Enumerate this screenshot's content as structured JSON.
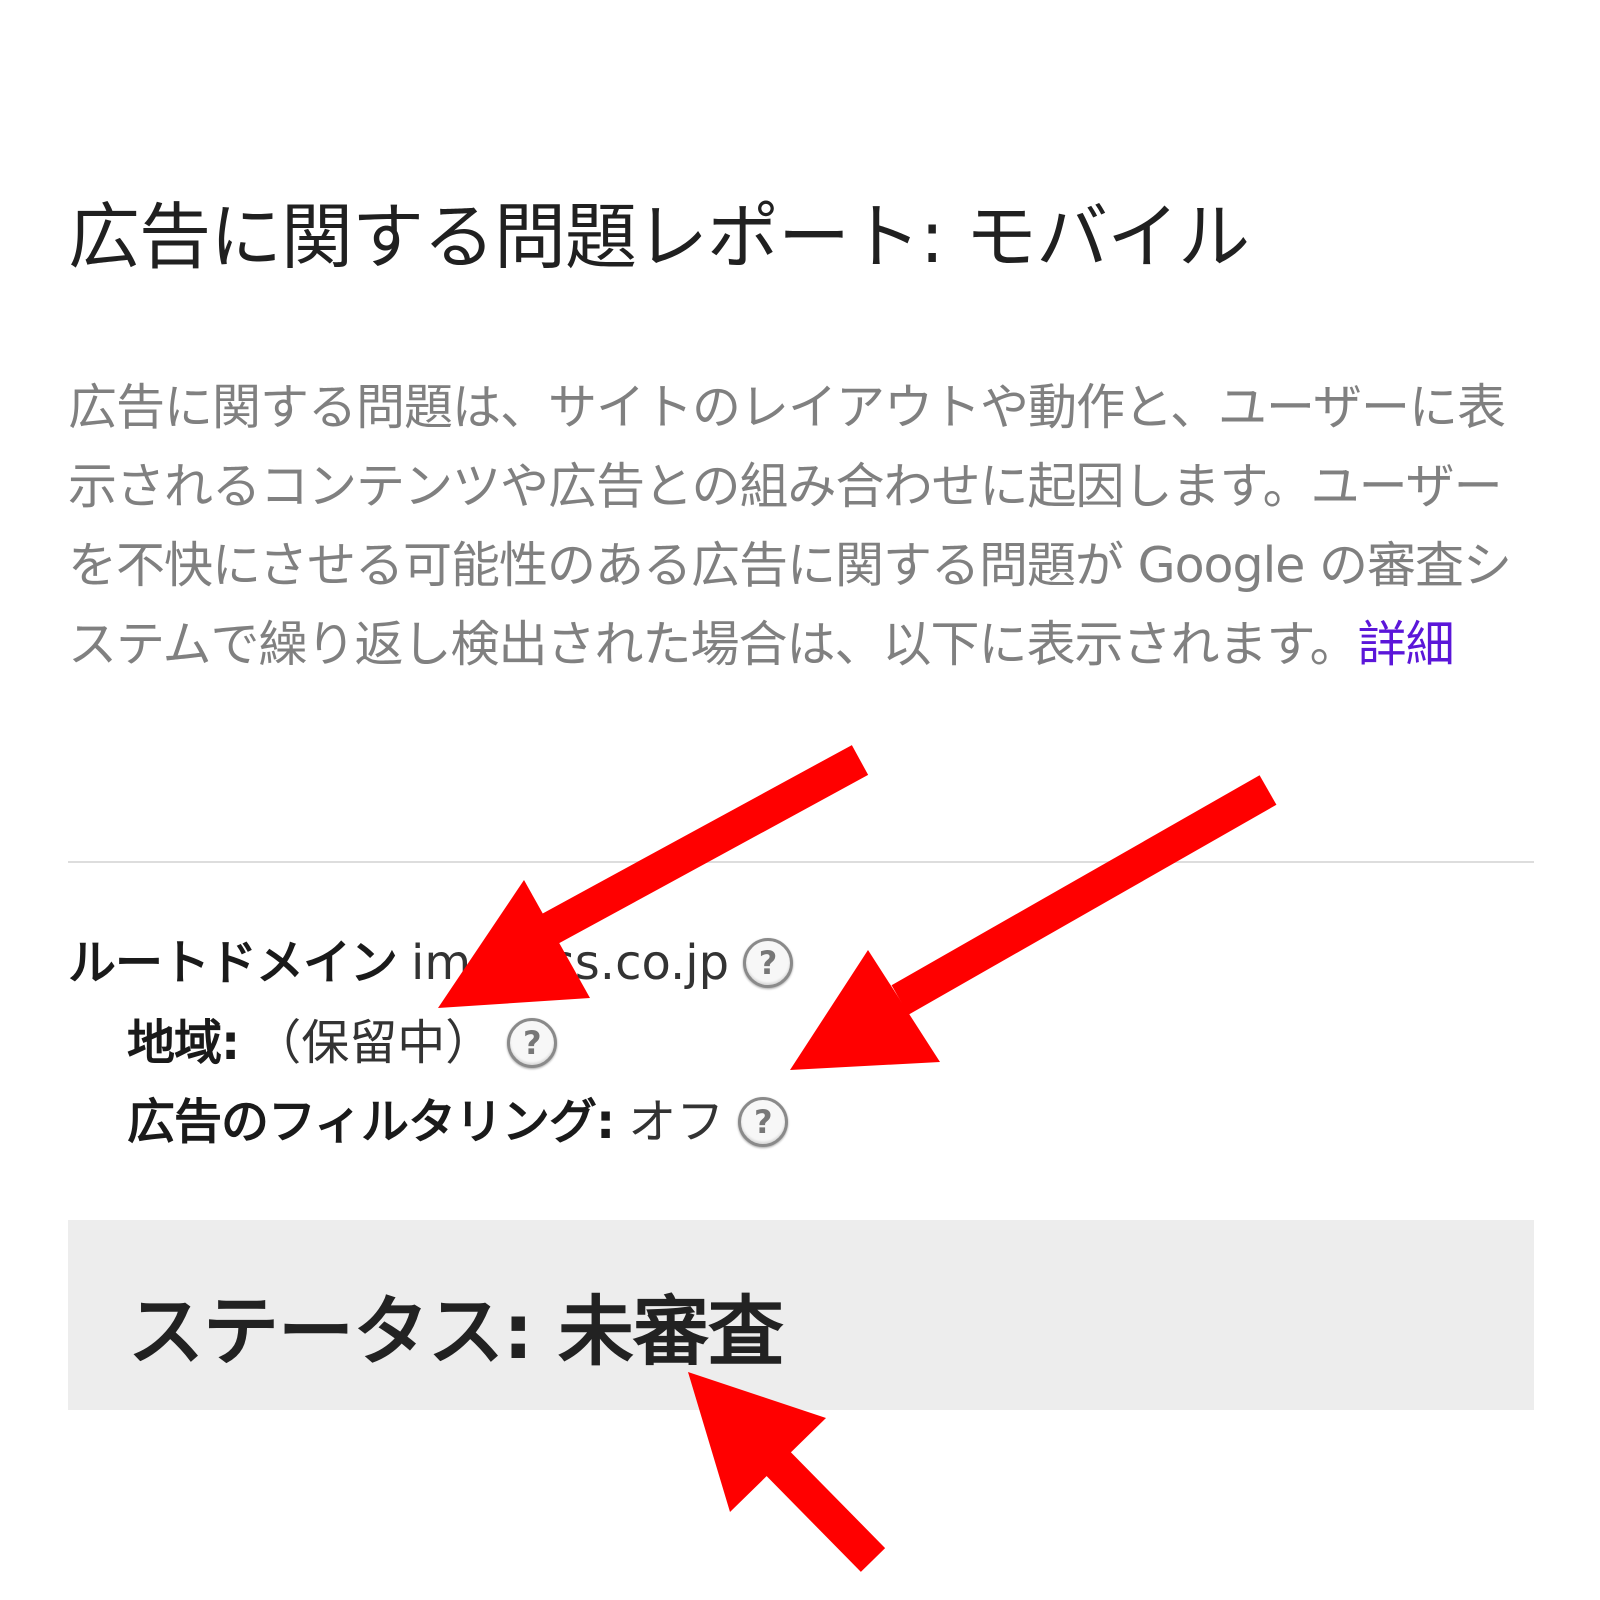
{
  "header": {
    "title": "広告に関する問題レポート: モバイル"
  },
  "description": {
    "text": "広告に関する問題は、サイトのレイアウトや動作と、ユーザーに表示されるコンテンツや広告との組み合わせに起因します。ユーザーを不快にさせる可能性のある広告に関する問題が Google の審査システムで繰り返し検出された場合は、以下に表示されます。",
    "link_label": "詳細"
  },
  "details": {
    "root_domain_label": "ルートドメイン",
    "root_domain_value": "impress.co.jp",
    "region_label": "地域:",
    "region_value": "（保留中）",
    "ad_filtering_label": "広告のフィルタリング:",
    "ad_filtering_value": "オフ",
    "help_glyph": "?"
  },
  "status": {
    "text": "ステータス: 未審査"
  },
  "annotations": {
    "arrow_color": "#ff0000",
    "count": 3
  },
  "colors": {
    "link": "#5b16d9",
    "description_text": "#808080",
    "status_background": "#ededed"
  }
}
